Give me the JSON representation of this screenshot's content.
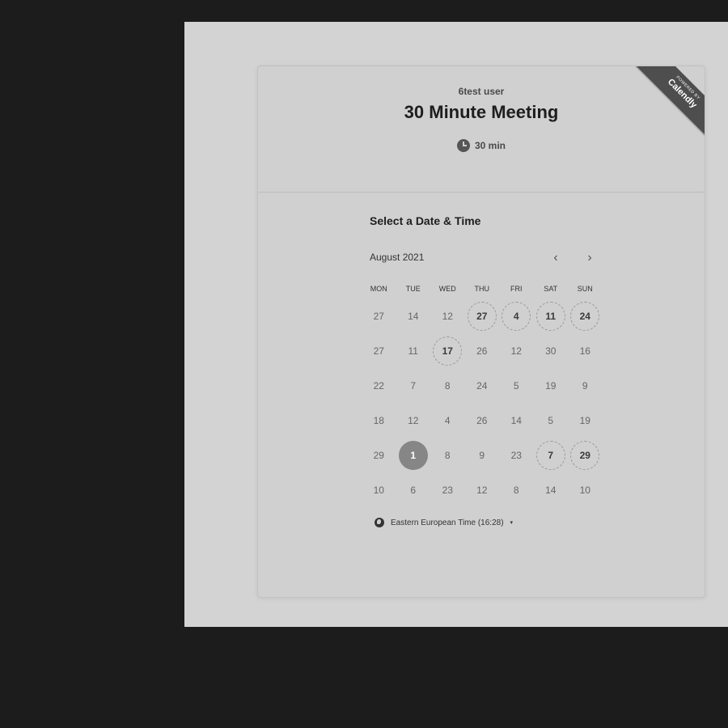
{
  "ribbon": {
    "powered_by": "POWERED BY",
    "brand": "Calendly"
  },
  "header": {
    "host_name": "6test user",
    "event_title": "30 Minute Meeting",
    "duration": "30 min"
  },
  "calendar": {
    "section_title": "Select a Date & Time",
    "month_label": "August 2021",
    "prev_icon": "‹",
    "next_icon": "›",
    "weekdays": [
      "MON",
      "TUE",
      "WED",
      "THU",
      "FRI",
      "SAT",
      "SUN"
    ],
    "weeks": [
      [
        "27",
        "14",
        "12",
        "27",
        "4",
        "11",
        "24"
      ],
      [
        "27",
        "11",
        "17",
        "26",
        "12",
        "30",
        "16"
      ],
      [
        "22",
        "7",
        "8",
        "24",
        "5",
        "19",
        "9"
      ],
      [
        "18",
        "12",
        "4",
        "26",
        "14",
        "5",
        "19"
      ],
      [
        "29",
        "1",
        "8",
        "9",
        "23",
        "7",
        "29"
      ],
      [
        "10",
        "6",
        "23",
        "12",
        "8",
        "14",
        "10"
      ]
    ],
    "selected_date": "1"
  },
  "timezone": {
    "label": "Eastern European Time (16:28)",
    "caret": "▾"
  }
}
